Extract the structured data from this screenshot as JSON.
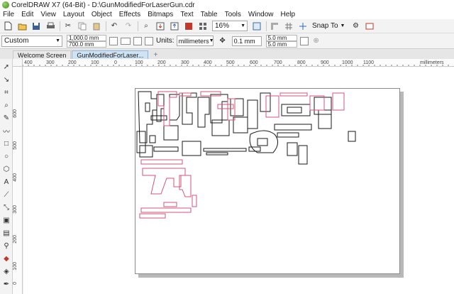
{
  "window": {
    "title": "CorelDRAW X7 (64-Bit) - D:\\GunModifiedForLaserGun.cdr"
  },
  "menu": [
    "File",
    "Edit",
    "View",
    "Layout",
    "Object",
    "Effects",
    "Bitmaps",
    "Text",
    "Table",
    "Tools",
    "Window",
    "Help"
  ],
  "toolbar": {
    "zoom": "16%",
    "snap_label": "Snap To"
  },
  "propbar": {
    "preset": "Custom",
    "width": "1,000.0 mm",
    "height": "700.0 mm",
    "units_label": "Units:",
    "units": "millimeters",
    "nudge": "0.1 mm",
    "dup_x": "5.0 mm",
    "dup_y": "5.0 mm"
  },
  "tabs": [
    "Welcome Screen",
    "GunModifiedForLaser..."
  ],
  "ruler_h": [
    "400",
    "300",
    "200",
    "100",
    "0",
    "100",
    "200",
    "300",
    "400",
    "500",
    "600",
    "700",
    "800",
    "900",
    "1000",
    "1100",
    "millimeters"
  ],
  "ruler_v": [
    "600",
    "500",
    "400",
    "300",
    "200",
    "100",
    "0"
  ],
  "colors": {
    "black_outline": "#1a1a1a",
    "red_outline": "#d2557a",
    "page_shadow": "#b8b8b8"
  },
  "icons": [
    "new-icon",
    "open-icon",
    "save-icon",
    "print-icon",
    "cut-icon",
    "copy-icon",
    "paste-icon",
    "undo-icon",
    "redo-icon",
    "search-icon",
    "import-icon",
    "export-icon",
    "publish-pdf-icon",
    "launcher-icon",
    "full-screen-icon",
    "show-rulers-icon",
    "show-grid-icon",
    "show-guidelines-icon",
    "options-icon",
    "application-launcher-icon"
  ]
}
